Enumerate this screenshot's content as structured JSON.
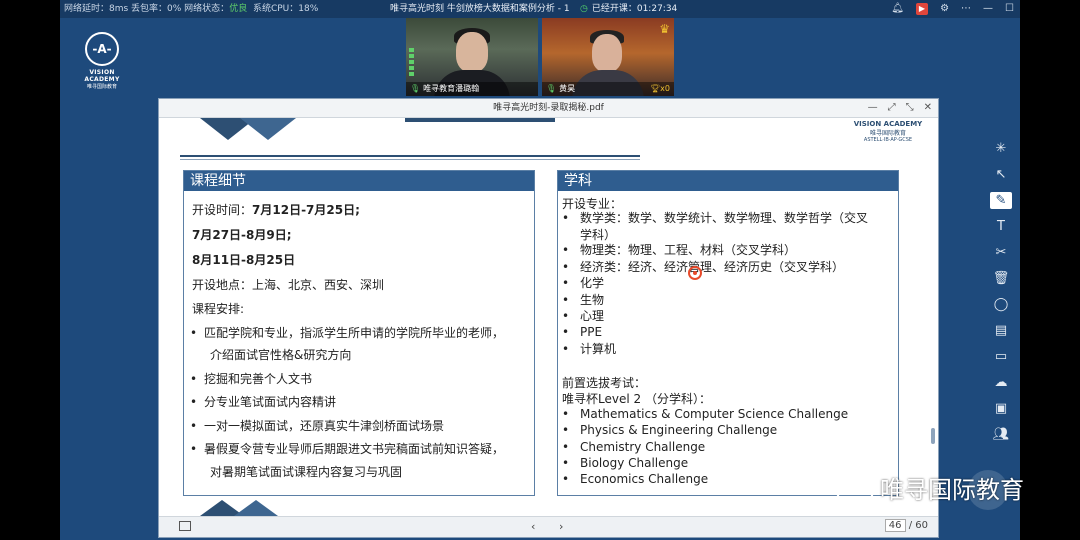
{
  "topbar": {
    "stats_prefix": "网络延时：8ms 丢包率：0% 网络状态：",
    "net_status": "优良",
    "cpu": "系统CPU：18%",
    "title": "唯寻高光时刻 牛剑放榜大数据和案例分析 - 1",
    "elapsed": "已经开课：01:27:34"
  },
  "logo": {
    "mark": "-A-",
    "name": "VISION ACADEMY",
    "cn": "唯寻国际教育"
  },
  "videos": [
    {
      "label": "唯寻教育潘璐翰"
    },
    {
      "label": "黄昊",
      "count": "x0"
    }
  ],
  "viewer": {
    "title": "唯寻高光时刻-录取揭秘.pdf",
    "page_current": "46",
    "page_total": "/ 60"
  },
  "slide": {
    "brand_line1": "VISION ACADEMY",
    "brand_line2": "唯寻国际教育",
    "brand_line3": "ASTELL·IB·AP·GCSE",
    "left": {
      "heading": "课程细节",
      "time_label": "开设时间：",
      "time_1": "7月12日-7月25日;",
      "time_2": "7月27日-8月9日;",
      "time_3": "8月11日-8月25日",
      "location": "开设地点：上海、北京、西安、深圳",
      "schedule_label": "课程安排:",
      "bullets": [
        "匹配学院和专业，指派学生所申请的学院所毕业的老师，",
        "挖掘和完善个人文书",
        "分专业笔试面试内容精讲",
        "一对一模拟面试，还原真实牛津剑桥面试场景",
        "暑假夏令营专业导师后期跟进文书完稿面试前知识答疑，"
      ],
      "bullet_1_cont": "介绍面试官性格&研究方向",
      "bullet_5_cont": "对暑期笔试面试课程内容复习与巩固"
    },
    "right": {
      "heading": "学科",
      "majors_label": "开设专业：",
      "majors": [
        "数学类：数学、数学统计、数学物理、数学哲学（交叉",
        "物理类：物理、工程、材料（交叉学科）",
        "经济类：经济、经济管理、经济历史（交叉学科）",
        "化学",
        "生物",
        "心理",
        "PPE",
        "计算机"
      ],
      "major_1_cont": "学科）",
      "exam_label": "前置选拔考试：",
      "cup": "唯寻杯Level 2 （分学科）：",
      "challenges": [
        "Mathematics & Computer Science Challenge",
        "Physics & Engineering Challenge",
        "Chemistry Challenge",
        "Biology Challenge",
        "Economics Challenge"
      ]
    }
  },
  "watermark": "唯寻国际教育",
  "colors": {
    "app_bg": "#1e4a7c",
    "slide_box": "#2f5d8f",
    "good": "#5fd06a"
  }
}
